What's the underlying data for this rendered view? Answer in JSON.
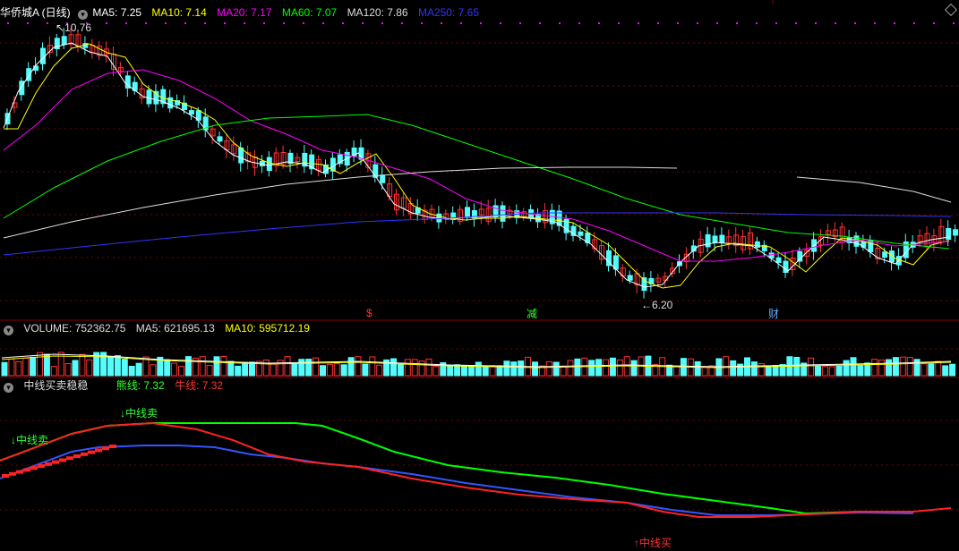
{
  "header": {
    "stock_title": "华侨城A (日线)",
    "ma": [
      {
        "label": "MA5: 7.25",
        "color": "#ffffff"
      },
      {
        "label": "MA10: 7.14",
        "color": "#ffff00"
      },
      {
        "label": "MA20: 7.17",
        "color": "#ff00ff"
      },
      {
        "label": "MA60: 7.07",
        "color": "#00ff00"
      },
      {
        "label": "MA120: 7.86",
        "color": "#dddddd"
      },
      {
        "label": "MA250: 7.65",
        "color": "#3333ff"
      }
    ]
  },
  "price_panel": {
    "high_label": "10.76",
    "low_label": "6.20",
    "markers": [
      {
        "text": "$",
        "color": "#ff3333"
      },
      {
        "text": "减",
        "color": "#33ff33"
      },
      {
        "text": "财",
        "color": "#66aaff"
      }
    ]
  },
  "volume_panel": {
    "title": "VOLUME: 752362.75",
    "ma5": "MA5: 621695.13",
    "ma10": "MA10: 595712.19"
  },
  "indicator_panel": {
    "title": "中线买卖稳稳",
    "line_bear": "熊线: 7.32",
    "line_bull": "牛线: 7.32",
    "signals": [
      {
        "text": "↓中线卖",
        "color": "#33ff33"
      },
      {
        "text": "↓中线卖",
        "color": "#33ff33"
      },
      {
        "text": "↑中线买",
        "color": "#ff3333"
      }
    ]
  },
  "colors": {
    "up": "#ff3333",
    "down": "#54fcfc",
    "ma5": "#ffffff",
    "ma10": "#ffff00",
    "ma20": "#ff00ff",
    "ma60": "#00ff00",
    "ma120": "#dddddd",
    "ma250": "#3333ff",
    "grid": "#7a0000"
  }
}
